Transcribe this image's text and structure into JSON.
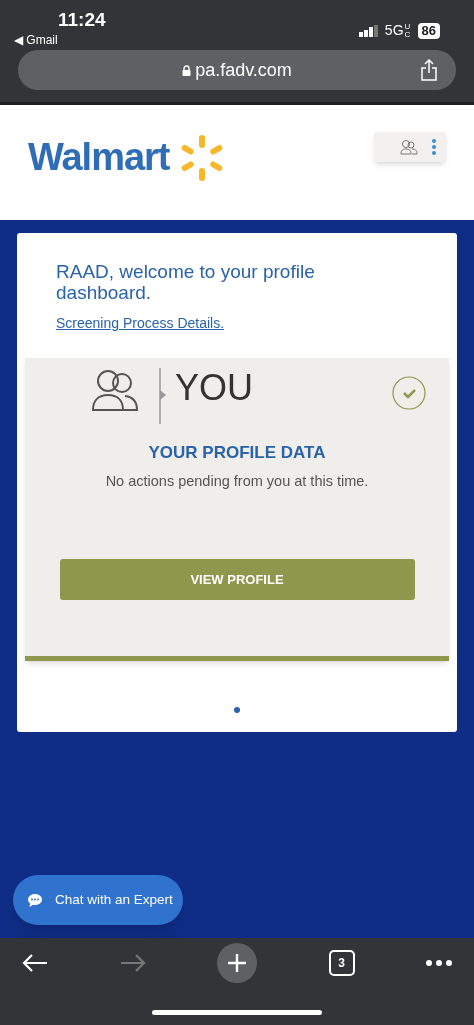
{
  "status_bar": {
    "time": "11:24",
    "back_app": "◀ Gmail",
    "network": "5G",
    "network_badge": "UC",
    "battery": "86"
  },
  "address_bar": {
    "url": "pa.fadv.com"
  },
  "header": {
    "logo_text": "Walmart"
  },
  "welcome": {
    "title": "RAAD, welcome to your profile dashboard.",
    "link": "Screening Process Details."
  },
  "profile_card": {
    "heading": "YOU",
    "completed": true,
    "title": "YOUR PROFILE DATA",
    "message": "No actions pending from you at this time.",
    "button": "VIEW PROFILE"
  },
  "pager": [
    {
      "selected": true
    }
  ],
  "chat_button": "Chat with an Expert",
  "toolbar": {
    "back_disabled": false,
    "forward_disabled": true,
    "tab_count": "3"
  }
}
